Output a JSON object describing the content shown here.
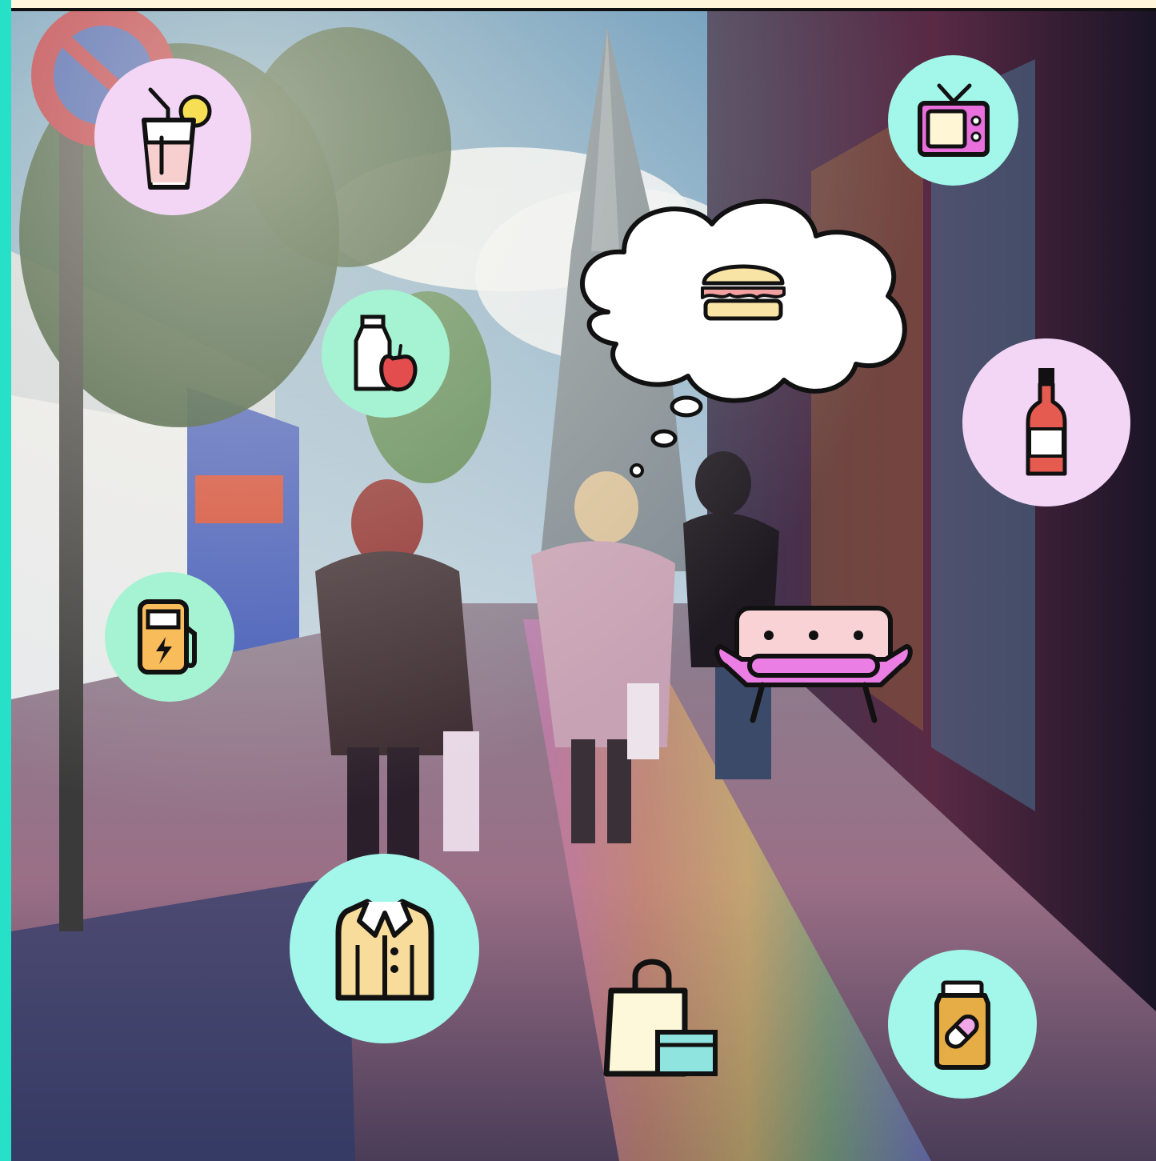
{
  "scene": {
    "palette": {
      "pink_circle": "#f3d6f6",
      "mint_circle": "#a6f3d3",
      "aqua_circle": "#a2f6ea",
      "frame_left": "#27e0c8",
      "frame_top": "#fff6dc",
      "outline": "#111111"
    },
    "icons": [
      "lemonade-drink-icon",
      "retro-tv-icon",
      "burger-icon",
      "milk-apple-grocery-icon",
      "wine-bottle-icon",
      "ev-charging-station-icon",
      "sofa-icon",
      "shirt-icon",
      "shopping-bag-icon",
      "medicine-bottle-icon"
    ]
  }
}
